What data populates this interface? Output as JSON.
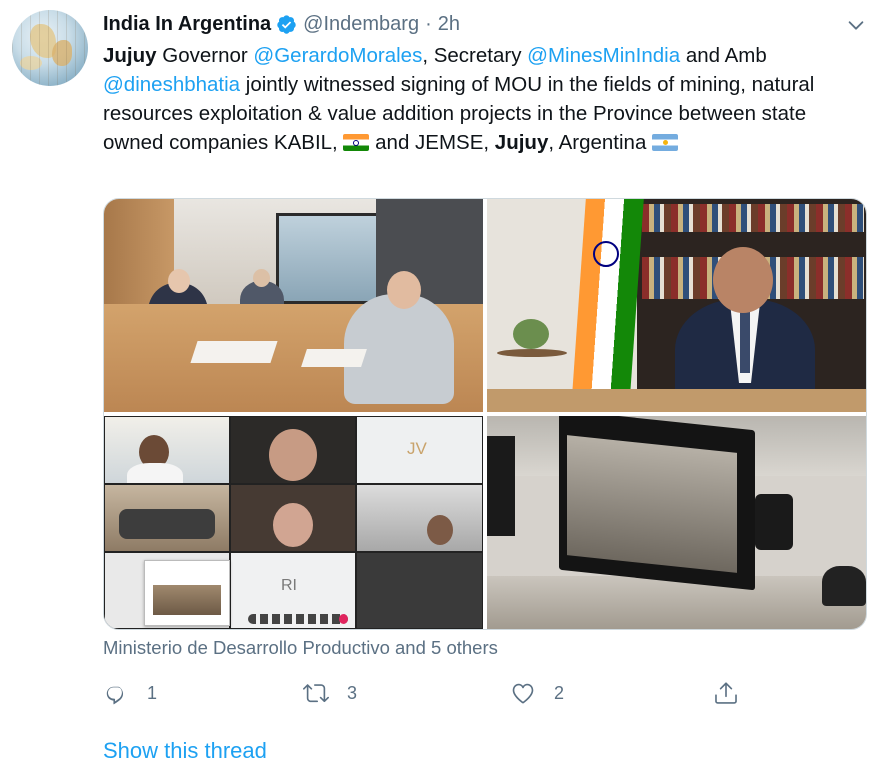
{
  "author": {
    "name": "India In Argentina",
    "handle": "@Indembarg",
    "separator": "·",
    "time": "2h",
    "verified": true
  },
  "tweet": {
    "segments": [
      {
        "text": "Jujuy",
        "style": "bold"
      },
      {
        "text": " Governor ",
        "style": "plain"
      },
      {
        "text": "@GerardoMorales",
        "style": "mention"
      },
      {
        "text": ", Secretary ",
        "style": "plain"
      },
      {
        "text": "@MinesMinIndia",
        "style": "mention"
      },
      {
        "text": " and Amb ",
        "style": "plain"
      },
      {
        "text": "@dineshbhatia",
        "style": "mention"
      },
      {
        "text": " jointly witnessed signing of MOU in the fields of mining, natural resources exploitation & value addition projects in the Province between state owned companies KABIL, ",
        "style": "plain"
      },
      {
        "emoji": "india-flag"
      },
      {
        "text": " and JEMSE, ",
        "style": "plain"
      },
      {
        "text": "Jujuy",
        "style": "bold"
      },
      {
        "text": ", Argentina ",
        "style": "plain"
      },
      {
        "emoji": "argentina-flag"
      }
    ]
  },
  "media": {
    "photos": [
      {
        "name": "photo-meeting-room"
      },
      {
        "name": "photo-ambassador"
      },
      {
        "name": "photo-video-call-grid",
        "tile_initials": [
          "JV",
          "RI"
        ]
      },
      {
        "name": "photo-video-screen"
      }
    ]
  },
  "tagged": "Ministerio de Desarrollo Productivo and 5 others",
  "actions": {
    "reply": {
      "count": "1",
      "icon": "reply-icon"
    },
    "retweet": {
      "count": "3",
      "icon": "retweet-icon"
    },
    "like": {
      "count": "2",
      "icon": "heart-icon"
    },
    "share": {
      "icon": "share-icon"
    }
  },
  "show_thread": "Show this thread",
  "colors": {
    "accent": "#1da1f2",
    "muted": "#5b7083",
    "text": "#0f1419",
    "border": "#cfd9de"
  }
}
